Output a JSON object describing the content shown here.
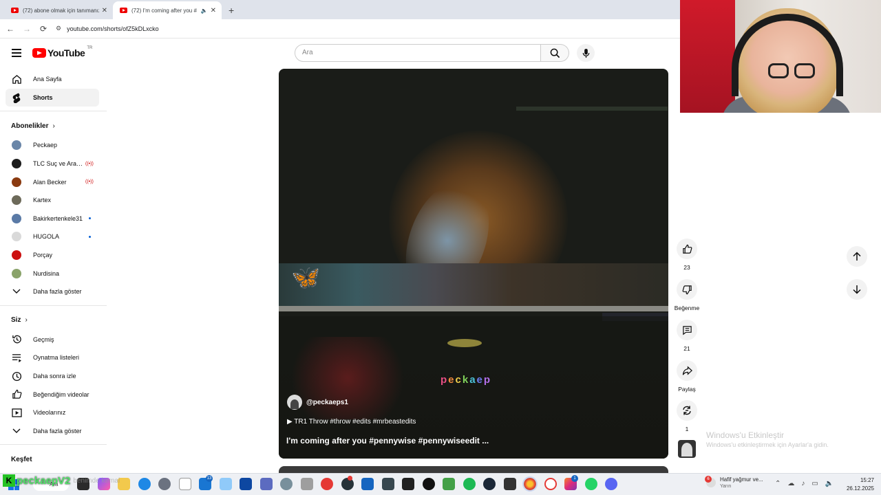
{
  "browser": {
    "tabs": [
      {
        "title": "(72) abone olmak için tanımanız"
      },
      {
        "title": "(72) I'm coming after you #"
      }
    ],
    "url": "youtube.com/shorts/ofZ5kDLxcko"
  },
  "header": {
    "logo_text": "YouTube",
    "country": "TR",
    "search_placeholder": "Ara"
  },
  "sidebar": {
    "top": [
      {
        "label": "Ana Sayfa",
        "icon": "home-icon"
      },
      {
        "label": "Shorts",
        "icon": "shorts-icon"
      }
    ],
    "subscriptions_title": "Abonelikler",
    "subscriptions": [
      {
        "label": "Peckaep",
        "avatar": "#6a86a8",
        "indicator": ""
      },
      {
        "label": "TLC Suç ve Araştırma",
        "avatar": "#1c1c1c",
        "indicator": "live"
      },
      {
        "label": "Alan Becker",
        "avatar": "#8a3a10",
        "indicator": "live"
      },
      {
        "label": "Kartex",
        "avatar": "#6d6a5a",
        "indicator": ""
      },
      {
        "label": "Bakirkertenkele31",
        "avatar": "#5a7aa6",
        "indicator": "dot"
      },
      {
        "label": "HUGOLA",
        "avatar": "#d9d9d9",
        "indicator": "dot"
      },
      {
        "label": "Porçay",
        "avatar": "#cc1010",
        "indicator": ""
      },
      {
        "label": "Nurdisina",
        "avatar": "#8aa36a",
        "indicator": ""
      }
    ],
    "show_more_1": "Daha fazla göster",
    "you_title": "Siz",
    "you_items": [
      {
        "label": "Geçmiş",
        "icon": "history-icon"
      },
      {
        "label": "Oynatma listeleri",
        "icon": "playlists-icon"
      },
      {
        "label": "Daha sonra izle",
        "icon": "watch-later-icon"
      },
      {
        "label": "Beğendiğim videolar",
        "icon": "liked-videos-icon"
      },
      {
        "label": "Videolarınız",
        "icon": "your-videos-icon"
      }
    ],
    "show_more_2": "Daha fazla göster",
    "explore_title": "Keşfet"
  },
  "video": {
    "watermark": "peckaep",
    "channel": "@peckaeps1",
    "subtitle": "TR1 Throw #throw #edits #mrbeastedits",
    "title": "I'm coming after you #pennywise #pennywiseedit ..."
  },
  "actions": {
    "likes": "23",
    "dislike_label": "Beğenme",
    "comments": "21",
    "share_label": "Paylaş",
    "remix_count": "1"
  },
  "activation": {
    "line1": "Windows'u Etkinleştir",
    "line2": "Windows'u etkinleştirmek için Ayarlar'a gidin."
  },
  "taskbar": {
    "search_label": "Ara",
    "stream_name": "peckaepV2",
    "stream_sub": "benimde kemal",
    "weather_text": "Hafif yağmur ve...",
    "weather_sub": "Yarın",
    "weather_badge": "6",
    "time": "15:27",
    "date": "26.12.2025"
  }
}
